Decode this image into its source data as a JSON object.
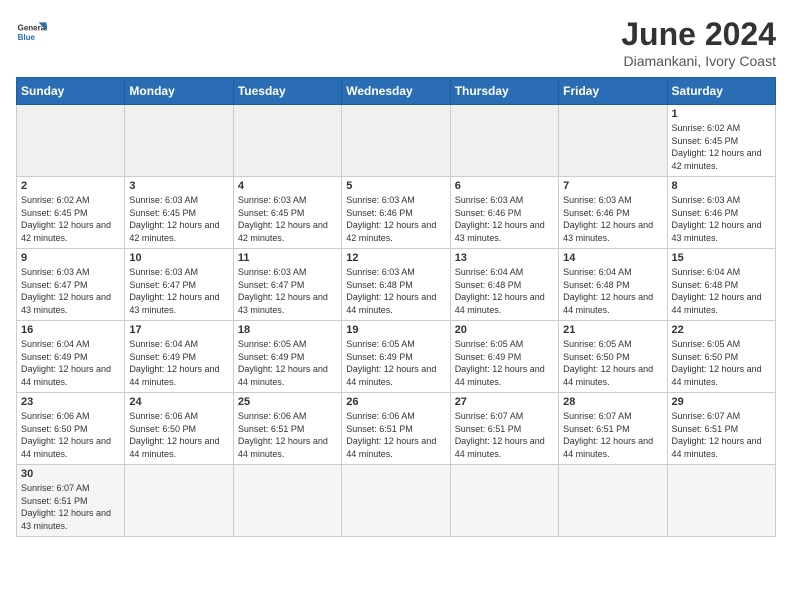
{
  "header": {
    "logo_general": "General",
    "logo_blue": "Blue",
    "title": "June 2024",
    "subtitle": "Diamankani, Ivory Coast"
  },
  "weekdays": [
    "Sunday",
    "Monday",
    "Tuesday",
    "Wednesday",
    "Thursday",
    "Friday",
    "Saturday"
  ],
  "weeks": [
    [
      {
        "day": "",
        "info": ""
      },
      {
        "day": "",
        "info": ""
      },
      {
        "day": "",
        "info": ""
      },
      {
        "day": "",
        "info": ""
      },
      {
        "day": "",
        "info": ""
      },
      {
        "day": "",
        "info": ""
      },
      {
        "day": "1",
        "info": "Sunrise: 6:02 AM\nSunset: 6:45 PM\nDaylight: 12 hours and 42 minutes."
      }
    ],
    [
      {
        "day": "2",
        "info": "Sunrise: 6:02 AM\nSunset: 6:45 PM\nDaylight: 12 hours and 42 minutes."
      },
      {
        "day": "3",
        "info": "Sunrise: 6:03 AM\nSunset: 6:45 PM\nDaylight: 12 hours and 42 minutes."
      },
      {
        "day": "4",
        "info": "Sunrise: 6:03 AM\nSunset: 6:45 PM\nDaylight: 12 hours and 42 minutes."
      },
      {
        "day": "5",
        "info": "Sunrise: 6:03 AM\nSunset: 6:46 PM\nDaylight: 12 hours and 42 minutes."
      },
      {
        "day": "6",
        "info": "Sunrise: 6:03 AM\nSunset: 6:46 PM\nDaylight: 12 hours and 43 minutes."
      },
      {
        "day": "7",
        "info": "Sunrise: 6:03 AM\nSunset: 6:46 PM\nDaylight: 12 hours and 43 minutes."
      },
      {
        "day": "8",
        "info": "Sunrise: 6:03 AM\nSunset: 6:46 PM\nDaylight: 12 hours and 43 minutes."
      }
    ],
    [
      {
        "day": "9",
        "info": "Sunrise: 6:03 AM\nSunset: 6:47 PM\nDaylight: 12 hours and 43 minutes."
      },
      {
        "day": "10",
        "info": "Sunrise: 6:03 AM\nSunset: 6:47 PM\nDaylight: 12 hours and 43 minutes."
      },
      {
        "day": "11",
        "info": "Sunrise: 6:03 AM\nSunset: 6:47 PM\nDaylight: 12 hours and 43 minutes."
      },
      {
        "day": "12",
        "info": "Sunrise: 6:03 AM\nSunset: 6:48 PM\nDaylight: 12 hours and 44 minutes."
      },
      {
        "day": "13",
        "info": "Sunrise: 6:04 AM\nSunset: 6:48 PM\nDaylight: 12 hours and 44 minutes."
      },
      {
        "day": "14",
        "info": "Sunrise: 6:04 AM\nSunset: 6:48 PM\nDaylight: 12 hours and 44 minutes."
      },
      {
        "day": "15",
        "info": "Sunrise: 6:04 AM\nSunset: 6:48 PM\nDaylight: 12 hours and 44 minutes."
      }
    ],
    [
      {
        "day": "16",
        "info": "Sunrise: 6:04 AM\nSunset: 6:49 PM\nDaylight: 12 hours and 44 minutes."
      },
      {
        "day": "17",
        "info": "Sunrise: 6:04 AM\nSunset: 6:49 PM\nDaylight: 12 hours and 44 minutes."
      },
      {
        "day": "18",
        "info": "Sunrise: 6:05 AM\nSunset: 6:49 PM\nDaylight: 12 hours and 44 minutes."
      },
      {
        "day": "19",
        "info": "Sunrise: 6:05 AM\nSunset: 6:49 PM\nDaylight: 12 hours and 44 minutes."
      },
      {
        "day": "20",
        "info": "Sunrise: 6:05 AM\nSunset: 6:49 PM\nDaylight: 12 hours and 44 minutes."
      },
      {
        "day": "21",
        "info": "Sunrise: 6:05 AM\nSunset: 6:50 PM\nDaylight: 12 hours and 44 minutes."
      },
      {
        "day": "22",
        "info": "Sunrise: 6:05 AM\nSunset: 6:50 PM\nDaylight: 12 hours and 44 minutes."
      }
    ],
    [
      {
        "day": "23",
        "info": "Sunrise: 6:06 AM\nSunset: 6:50 PM\nDaylight: 12 hours and 44 minutes."
      },
      {
        "day": "24",
        "info": "Sunrise: 6:06 AM\nSunset: 6:50 PM\nDaylight: 12 hours and 44 minutes."
      },
      {
        "day": "25",
        "info": "Sunrise: 6:06 AM\nSunset: 6:51 PM\nDaylight: 12 hours and 44 minutes."
      },
      {
        "day": "26",
        "info": "Sunrise: 6:06 AM\nSunset: 6:51 PM\nDaylight: 12 hours and 44 minutes."
      },
      {
        "day": "27",
        "info": "Sunrise: 6:07 AM\nSunset: 6:51 PM\nDaylight: 12 hours and 44 minutes."
      },
      {
        "day": "28",
        "info": "Sunrise: 6:07 AM\nSunset: 6:51 PM\nDaylight: 12 hours and 44 minutes."
      },
      {
        "day": "29",
        "info": "Sunrise: 6:07 AM\nSunset: 6:51 PM\nDaylight: 12 hours and 44 minutes."
      }
    ],
    [
      {
        "day": "30",
        "info": "Sunrise: 6:07 AM\nSunset: 6:51 PM\nDaylight: 12 hours and 43 minutes."
      },
      {
        "day": "",
        "info": ""
      },
      {
        "day": "",
        "info": ""
      },
      {
        "day": "",
        "info": ""
      },
      {
        "day": "",
        "info": ""
      },
      {
        "day": "",
        "info": ""
      },
      {
        "day": "",
        "info": ""
      }
    ]
  ]
}
